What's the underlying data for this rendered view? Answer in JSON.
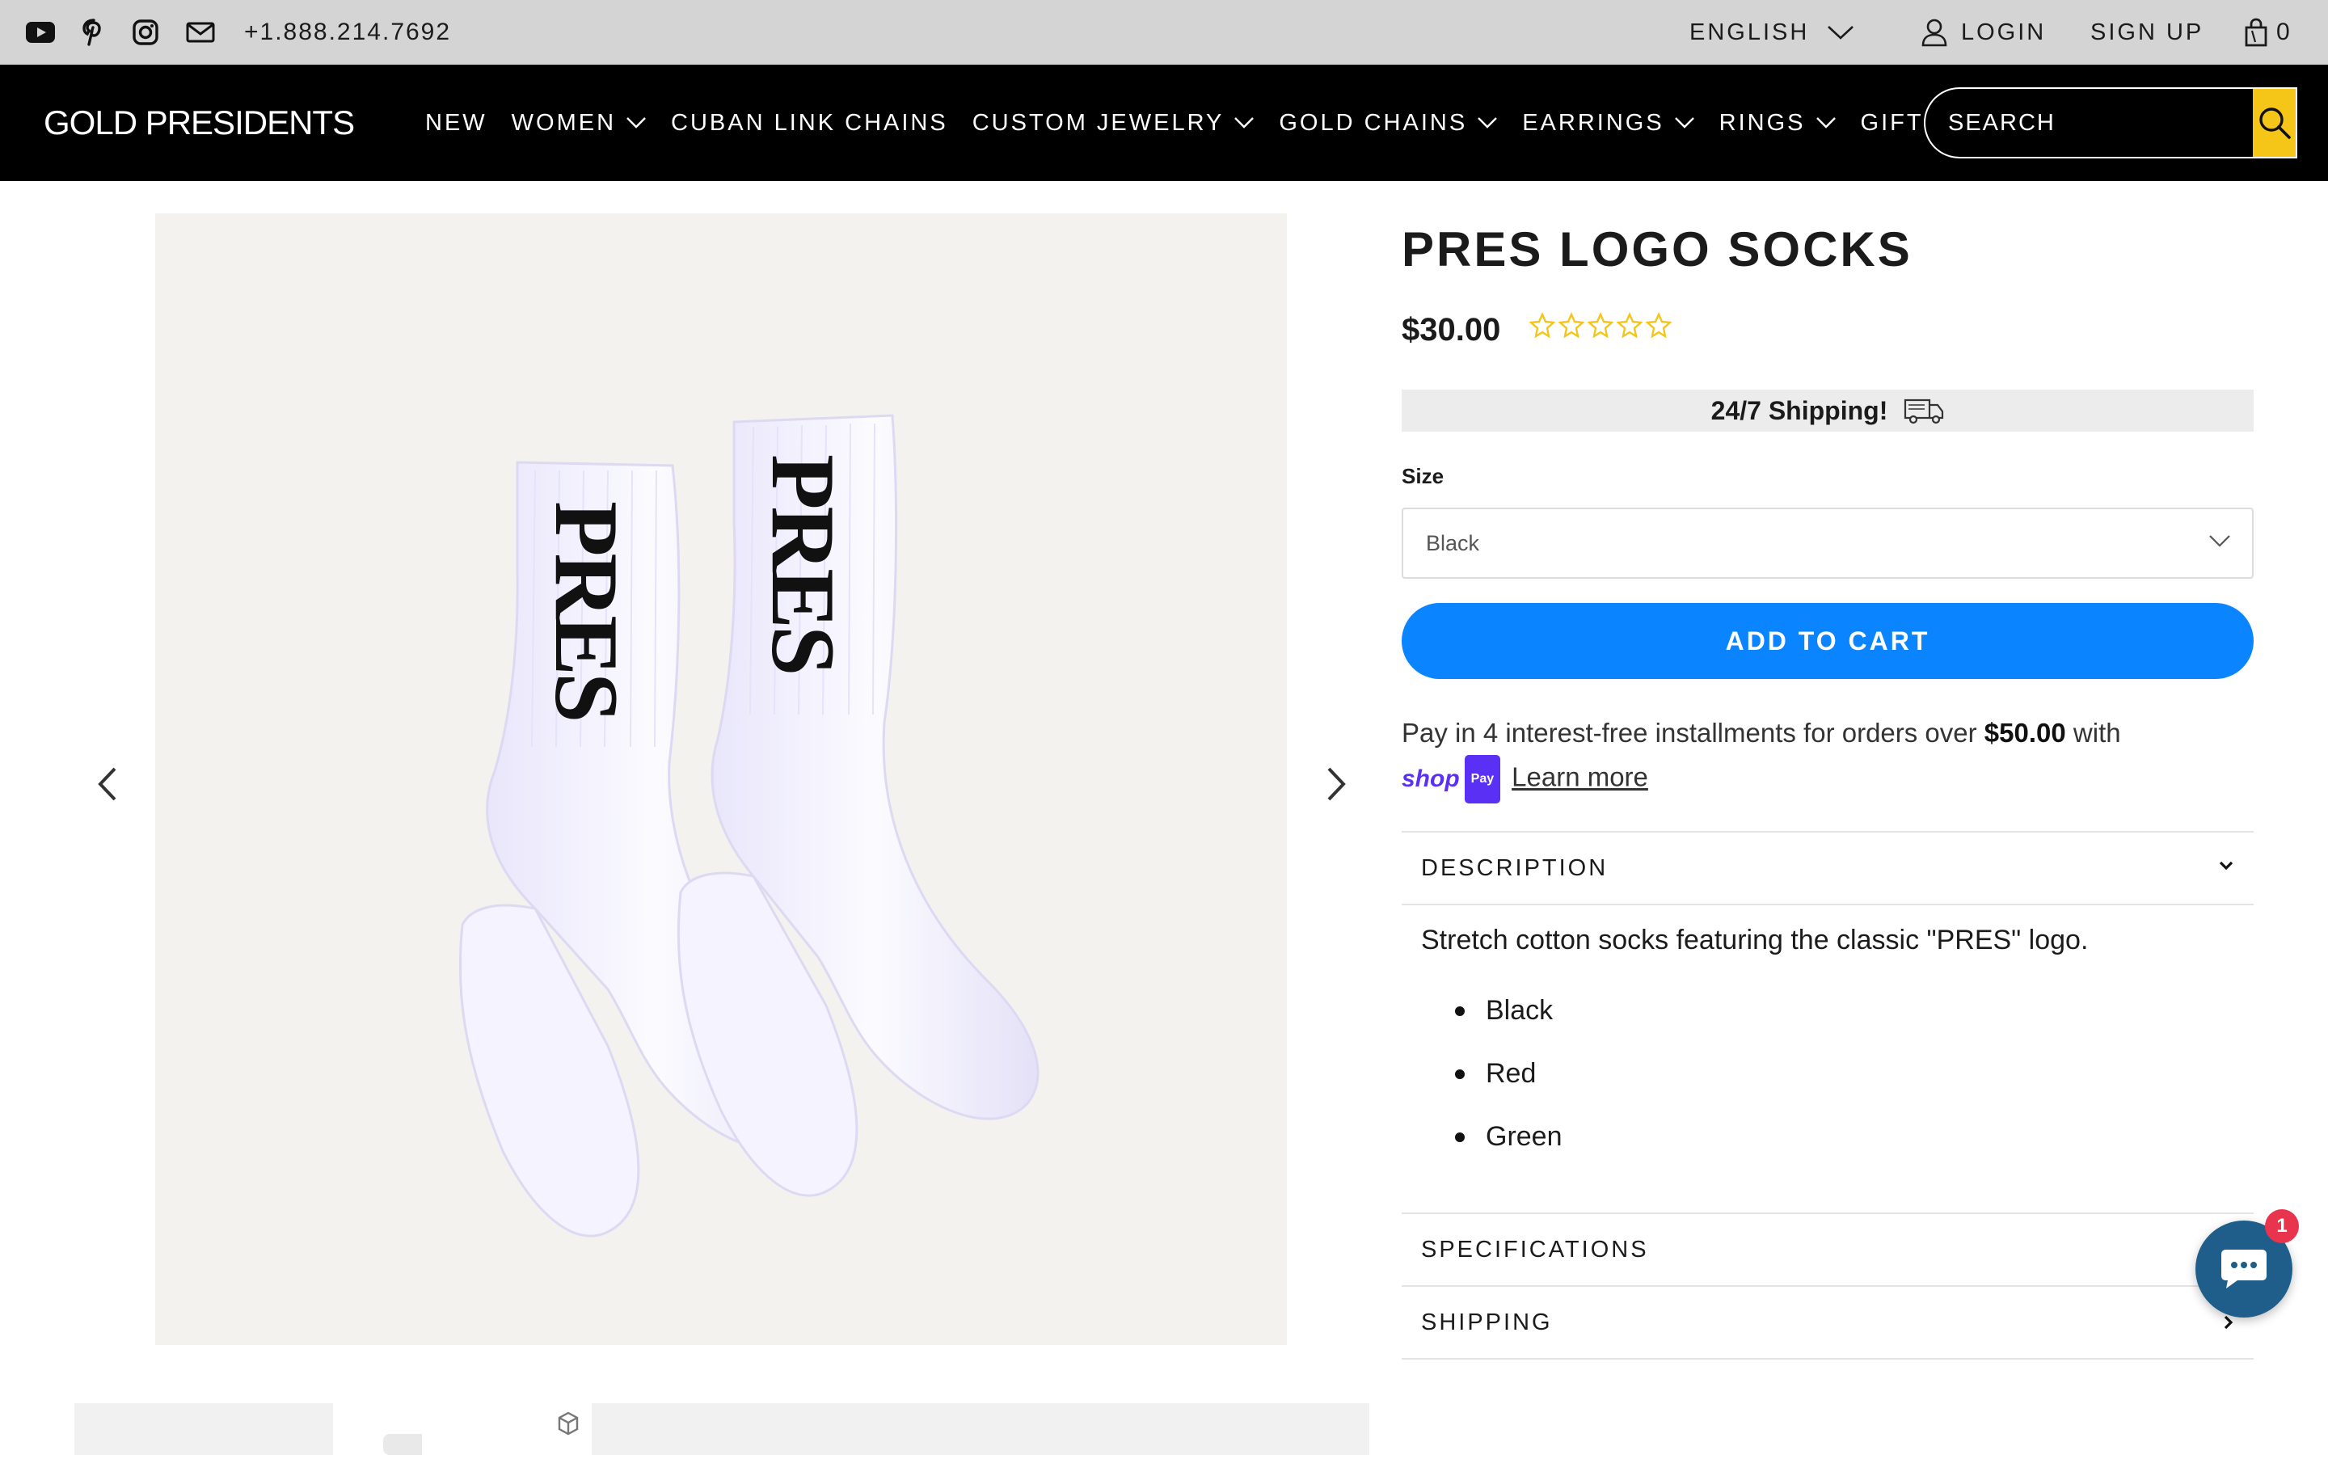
{
  "topbar": {
    "social_icons": [
      "youtube-icon",
      "pinterest-icon",
      "instagram-icon",
      "mail-icon"
    ],
    "phone": "+1.888.214.7692",
    "language": "ENGLISH",
    "login": "LOGIN",
    "signup": "SIGN UP",
    "cart_count": "0"
  },
  "navbar": {
    "logo": "GOLD PRESIDENTS",
    "menu": [
      {
        "label": "NEW",
        "dropdown": false
      },
      {
        "label": "WOMEN",
        "dropdown": true
      },
      {
        "label": "CUBAN LINK CHAINS",
        "dropdown": false
      },
      {
        "label": "CUSTOM JEWELRY",
        "dropdown": true
      },
      {
        "label": "GOLD CHAINS",
        "dropdown": true
      },
      {
        "label": "EARRINGS",
        "dropdown": true
      },
      {
        "label": "RINGS",
        "dropdown": true
      },
      {
        "label": "GIFTS",
        "dropdown": true
      }
    ],
    "search_placeholder": "SEARCH"
  },
  "gallery": {
    "sock_text": "PRES",
    "image_bg": "#f3f2ef"
  },
  "product": {
    "title": "PRES LOGO SOCKS",
    "price": "$30.00",
    "rating_stars": 5,
    "rating_filled": 0,
    "shipping_banner": "24/7 Shipping!",
    "size_label": "Size",
    "size_selected": "Black",
    "add_to_cart": "ADD TO CART",
    "installments": {
      "text_before": "Pay in 4 interest-free installments for orders over ",
      "amount": "$50.00",
      "text_after": " with",
      "shoppay_word": "shop",
      "shoppay_badge": "Pay",
      "learn_more": "Learn more"
    },
    "accordion": {
      "description_label": "DESCRIPTION",
      "description_text": "Stretch cotton socks featuring the classic \"PRES\" logo.",
      "colors": [
        "Black",
        "Red",
        "Green"
      ],
      "specifications_label": "SPECIFICATIONS",
      "shipping_label": "SHIPPING"
    }
  },
  "chat": {
    "badge_count": "1"
  },
  "colors": {
    "topbar_bg": "#d4d4d4",
    "nav_bg": "#000000",
    "search_button": "#f5c518",
    "add_to_cart_bg": "#0a84ff",
    "shop_pay": "#5a31f4",
    "chat_bg": "#1f5e8a",
    "badge": "#e8344d",
    "star": "#f5c518"
  }
}
